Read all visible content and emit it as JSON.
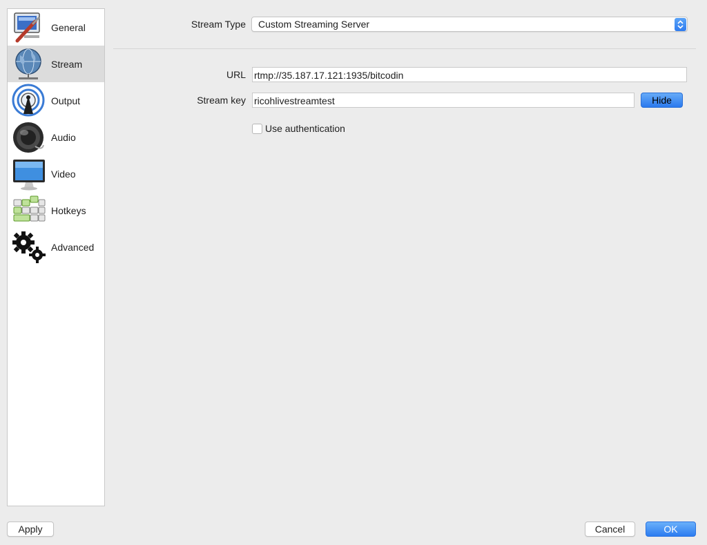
{
  "sidebar": {
    "items": [
      {
        "label": "General",
        "icon": "general-icon"
      },
      {
        "label": "Stream",
        "icon": "stream-globe-icon",
        "selected": true
      },
      {
        "label": "Output",
        "icon": "output-broadcast-icon"
      },
      {
        "label": "Audio",
        "icon": "audio-speaker-icon"
      },
      {
        "label": "Video",
        "icon": "video-monitor-icon"
      },
      {
        "label": "Hotkeys",
        "icon": "hotkeys-keyboard-icon"
      },
      {
        "label": "Advanced",
        "icon": "advanced-gears-icon"
      }
    ]
  },
  "stream": {
    "type_label": "Stream Type",
    "type_value": "Custom Streaming Server",
    "url_label": "URL",
    "url_value": "rtmp://35.187.17.121:1935/bitcodin",
    "key_label": "Stream key",
    "key_value": "ricohlivestreamtest",
    "hide_label": "Hide",
    "auth_label": "Use authentication",
    "auth_checked": false
  },
  "footer": {
    "apply_label": "Apply",
    "cancel_label": "Cancel",
    "ok_label": "OK"
  },
  "colors": {
    "accent": "#2f7cf0",
    "selected_row": "#dcdcdc",
    "window_bg": "#ececec"
  }
}
